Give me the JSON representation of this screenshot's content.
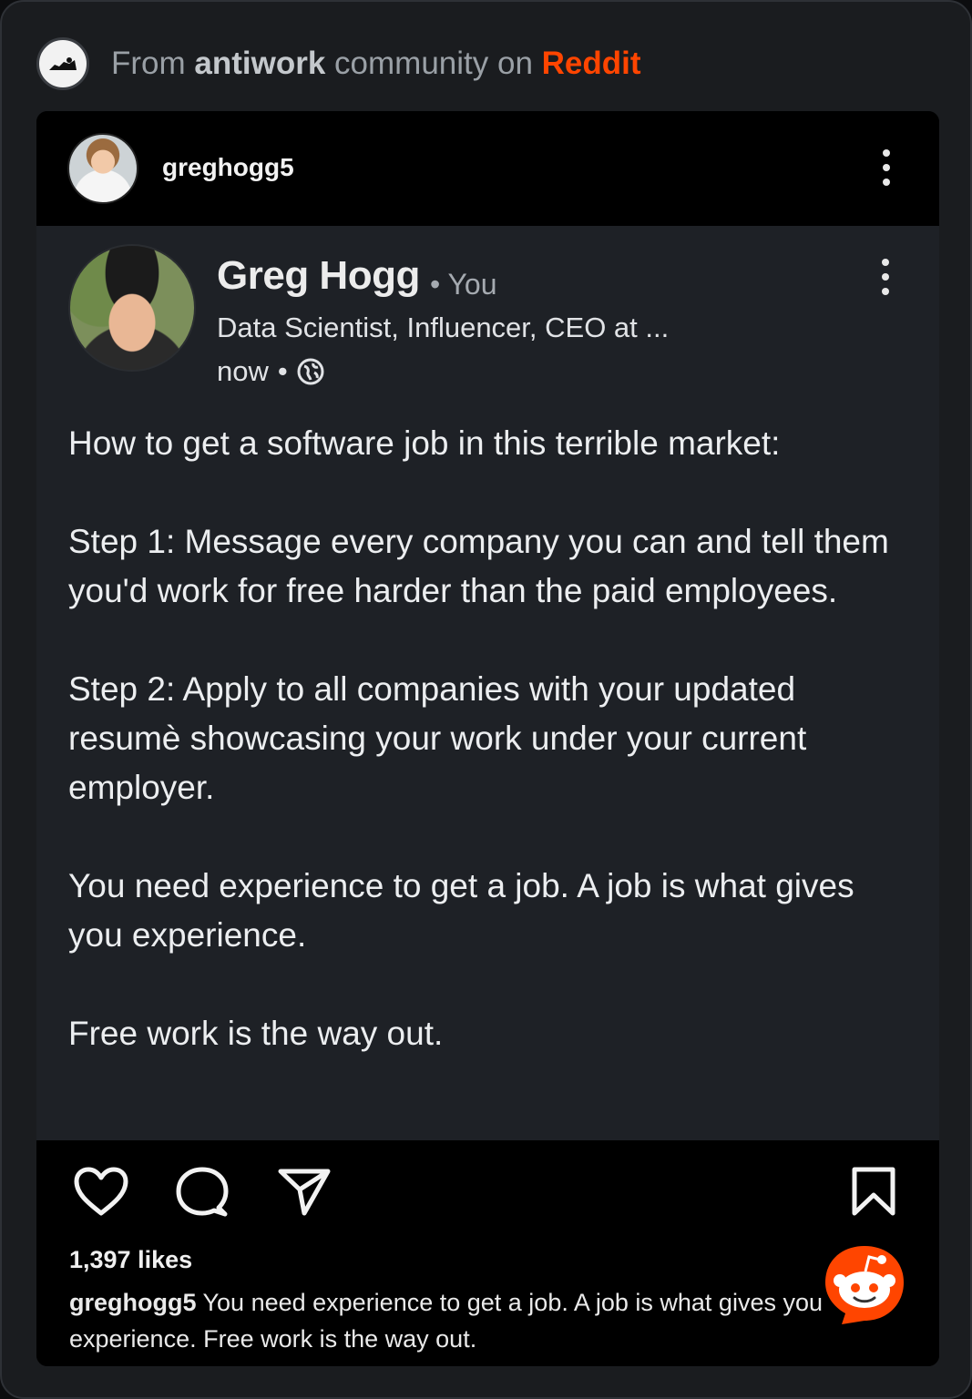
{
  "source": {
    "prefix": "From",
    "community": "antiwork",
    "middle": "community on",
    "platform": "Reddit",
    "avatar_icon": "antiwork-community-icon",
    "platform_color": "#ff4500"
  },
  "post_header": {
    "username": "greghogg5",
    "menu_icon": "more-vertical-icon"
  },
  "linkedin_post": {
    "author": "Greg Hogg",
    "relation": "• You",
    "headline": "Data Scientist, Influencer, CEO at ...",
    "time": "now",
    "visibility_icon": "globe-icon",
    "body": [
      "How to get a software job in this terrible market:",
      "Step 1: Message every company you can and tell them you'd work for free harder than the paid employees.",
      "Step 2: Apply to all companies with your updated resumè showcasing your work under your current employer.",
      "You need experience to get a job. A job is what gives you experience.",
      "Free work is the way out."
    ]
  },
  "actions": {
    "like_icon": "heart-icon",
    "comment_icon": "comment-icon",
    "share_icon": "send-icon",
    "save_icon": "bookmark-icon",
    "likes": "1,397 likes",
    "caption_user": "greghogg5",
    "caption_text": "You need experience to get a job. A job is what gives you experience. Free work is the way out."
  },
  "overlay": {
    "icon": "reddit-snoo-icon",
    "color": "#ff4500"
  }
}
